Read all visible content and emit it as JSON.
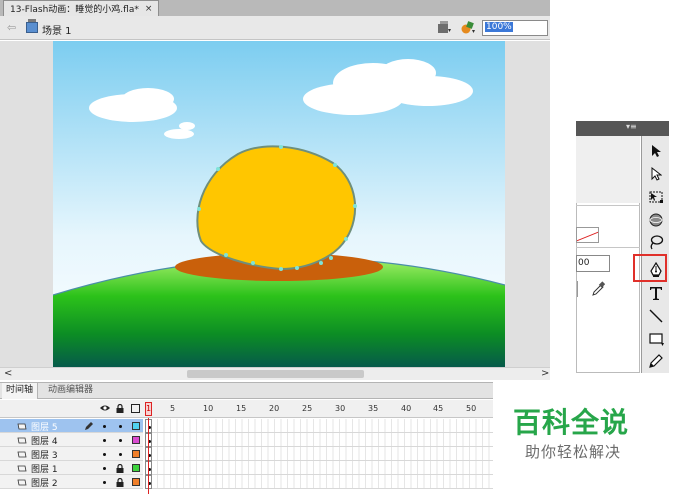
{
  "document": {
    "tab_title": "13-Flash动画：睡觉的小鸡.fla*",
    "tab_close": "×"
  },
  "editbar": {
    "back_arrow": "⇦",
    "scene_label": "场景 1",
    "zoom_value": "100%"
  },
  "scrollbar": {
    "left_arrow": "<",
    "right_arrow": ">"
  },
  "timeline": {
    "tabs": [
      "时间轴",
      "动画编辑器"
    ],
    "playhead_frame": "1",
    "frame_labels": [
      "5",
      "10",
      "15",
      "20",
      "25",
      "30",
      "35",
      "40",
      "45",
      "50"
    ],
    "layers": [
      {
        "name": "图层 5",
        "selected": true,
        "color": "#4fd3f0",
        "locked": false,
        "pencil": true
      },
      {
        "name": "图层 4",
        "selected": false,
        "color": "#d94bd0",
        "locked": false,
        "pencil": false
      },
      {
        "name": "图层 3",
        "selected": false,
        "color": "#f07f2a",
        "locked": false,
        "pencil": false
      },
      {
        "name": "图层 1",
        "selected": false,
        "color": "#3fd43f",
        "locked": true,
        "pencil": false
      },
      {
        "name": "图层 2",
        "selected": false,
        "color": "#f07f2a",
        "locked": true,
        "pencil": false
      }
    ]
  },
  "panel": {
    "menu_icon": "▾≡",
    "stroke_value": "00"
  },
  "tools": [
    "selection-tool",
    "subselection-tool",
    "free-transform-tool",
    "3d-rotation-tool",
    "lasso-tool",
    "pen-tool",
    "text-tool",
    "line-tool",
    "rectangle-tool",
    "pencil-tool"
  ],
  "watermark": {
    "main": "百科全说",
    "sub": "助你轻松解决"
  },
  "colors": {
    "sun_fill": "#ffc600",
    "ground_ellipse": "#c9600b",
    "sky_top": "#7ccdf0",
    "grass": "#22b014",
    "highlight": "#e0302a",
    "watermark_green": "#27a64a"
  }
}
